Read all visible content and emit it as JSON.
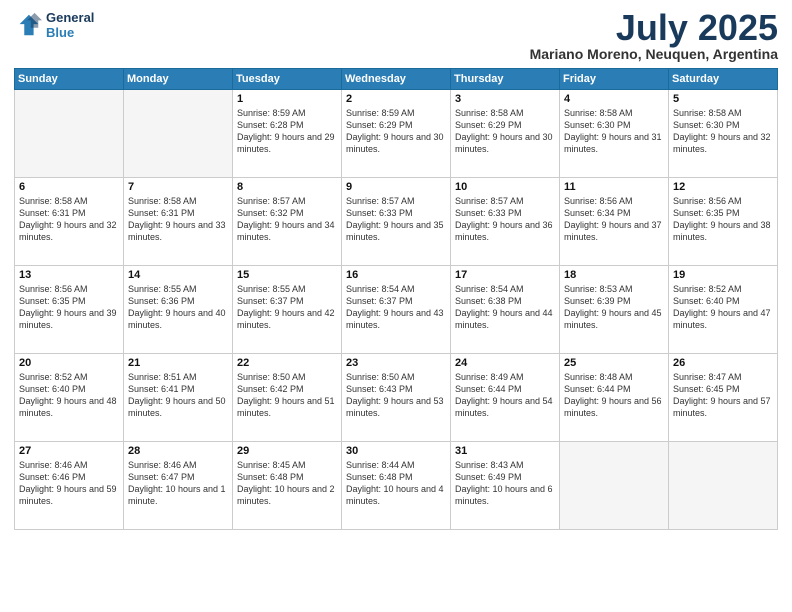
{
  "logo": {
    "line1": "General",
    "line2": "Blue"
  },
  "title": "July 2025",
  "location": "Mariano Moreno, Neuquen, Argentina",
  "weekdays": [
    "Sunday",
    "Monday",
    "Tuesday",
    "Wednesday",
    "Thursday",
    "Friday",
    "Saturday"
  ],
  "weeks": [
    [
      {
        "day": "",
        "sunrise": "",
        "sunset": "",
        "daylight": ""
      },
      {
        "day": "",
        "sunrise": "",
        "sunset": "",
        "daylight": ""
      },
      {
        "day": "1",
        "sunrise": "Sunrise: 8:59 AM",
        "sunset": "Sunset: 6:28 PM",
        "daylight": "Daylight: 9 hours and 29 minutes."
      },
      {
        "day": "2",
        "sunrise": "Sunrise: 8:59 AM",
        "sunset": "Sunset: 6:29 PM",
        "daylight": "Daylight: 9 hours and 30 minutes."
      },
      {
        "day": "3",
        "sunrise": "Sunrise: 8:58 AM",
        "sunset": "Sunset: 6:29 PM",
        "daylight": "Daylight: 9 hours and 30 minutes."
      },
      {
        "day": "4",
        "sunrise": "Sunrise: 8:58 AM",
        "sunset": "Sunset: 6:30 PM",
        "daylight": "Daylight: 9 hours and 31 minutes."
      },
      {
        "day": "5",
        "sunrise": "Sunrise: 8:58 AM",
        "sunset": "Sunset: 6:30 PM",
        "daylight": "Daylight: 9 hours and 32 minutes."
      }
    ],
    [
      {
        "day": "6",
        "sunrise": "Sunrise: 8:58 AM",
        "sunset": "Sunset: 6:31 PM",
        "daylight": "Daylight: 9 hours and 32 minutes."
      },
      {
        "day": "7",
        "sunrise": "Sunrise: 8:58 AM",
        "sunset": "Sunset: 6:31 PM",
        "daylight": "Daylight: 9 hours and 33 minutes."
      },
      {
        "day": "8",
        "sunrise": "Sunrise: 8:57 AM",
        "sunset": "Sunset: 6:32 PM",
        "daylight": "Daylight: 9 hours and 34 minutes."
      },
      {
        "day": "9",
        "sunrise": "Sunrise: 8:57 AM",
        "sunset": "Sunset: 6:33 PM",
        "daylight": "Daylight: 9 hours and 35 minutes."
      },
      {
        "day": "10",
        "sunrise": "Sunrise: 8:57 AM",
        "sunset": "Sunset: 6:33 PM",
        "daylight": "Daylight: 9 hours and 36 minutes."
      },
      {
        "day": "11",
        "sunrise": "Sunrise: 8:56 AM",
        "sunset": "Sunset: 6:34 PM",
        "daylight": "Daylight: 9 hours and 37 minutes."
      },
      {
        "day": "12",
        "sunrise": "Sunrise: 8:56 AM",
        "sunset": "Sunset: 6:35 PM",
        "daylight": "Daylight: 9 hours and 38 minutes."
      }
    ],
    [
      {
        "day": "13",
        "sunrise": "Sunrise: 8:56 AM",
        "sunset": "Sunset: 6:35 PM",
        "daylight": "Daylight: 9 hours and 39 minutes."
      },
      {
        "day": "14",
        "sunrise": "Sunrise: 8:55 AM",
        "sunset": "Sunset: 6:36 PM",
        "daylight": "Daylight: 9 hours and 40 minutes."
      },
      {
        "day": "15",
        "sunrise": "Sunrise: 8:55 AM",
        "sunset": "Sunset: 6:37 PM",
        "daylight": "Daylight: 9 hours and 42 minutes."
      },
      {
        "day": "16",
        "sunrise": "Sunrise: 8:54 AM",
        "sunset": "Sunset: 6:37 PM",
        "daylight": "Daylight: 9 hours and 43 minutes."
      },
      {
        "day": "17",
        "sunrise": "Sunrise: 8:54 AM",
        "sunset": "Sunset: 6:38 PM",
        "daylight": "Daylight: 9 hours and 44 minutes."
      },
      {
        "day": "18",
        "sunrise": "Sunrise: 8:53 AM",
        "sunset": "Sunset: 6:39 PM",
        "daylight": "Daylight: 9 hours and 45 minutes."
      },
      {
        "day": "19",
        "sunrise": "Sunrise: 8:52 AM",
        "sunset": "Sunset: 6:40 PM",
        "daylight": "Daylight: 9 hours and 47 minutes."
      }
    ],
    [
      {
        "day": "20",
        "sunrise": "Sunrise: 8:52 AM",
        "sunset": "Sunset: 6:40 PM",
        "daylight": "Daylight: 9 hours and 48 minutes."
      },
      {
        "day": "21",
        "sunrise": "Sunrise: 8:51 AM",
        "sunset": "Sunset: 6:41 PM",
        "daylight": "Daylight: 9 hours and 50 minutes."
      },
      {
        "day": "22",
        "sunrise": "Sunrise: 8:50 AM",
        "sunset": "Sunset: 6:42 PM",
        "daylight": "Daylight: 9 hours and 51 minutes."
      },
      {
        "day": "23",
        "sunrise": "Sunrise: 8:50 AM",
        "sunset": "Sunset: 6:43 PM",
        "daylight": "Daylight: 9 hours and 53 minutes."
      },
      {
        "day": "24",
        "sunrise": "Sunrise: 8:49 AM",
        "sunset": "Sunset: 6:44 PM",
        "daylight": "Daylight: 9 hours and 54 minutes."
      },
      {
        "day": "25",
        "sunrise": "Sunrise: 8:48 AM",
        "sunset": "Sunset: 6:44 PM",
        "daylight": "Daylight: 9 hours and 56 minutes."
      },
      {
        "day": "26",
        "sunrise": "Sunrise: 8:47 AM",
        "sunset": "Sunset: 6:45 PM",
        "daylight": "Daylight: 9 hours and 57 minutes."
      }
    ],
    [
      {
        "day": "27",
        "sunrise": "Sunrise: 8:46 AM",
        "sunset": "Sunset: 6:46 PM",
        "daylight": "Daylight: 9 hours and 59 minutes."
      },
      {
        "day": "28",
        "sunrise": "Sunrise: 8:46 AM",
        "sunset": "Sunset: 6:47 PM",
        "daylight": "Daylight: 10 hours and 1 minute."
      },
      {
        "day": "29",
        "sunrise": "Sunrise: 8:45 AM",
        "sunset": "Sunset: 6:48 PM",
        "daylight": "Daylight: 10 hours and 2 minutes."
      },
      {
        "day": "30",
        "sunrise": "Sunrise: 8:44 AM",
        "sunset": "Sunset: 6:48 PM",
        "daylight": "Daylight: 10 hours and 4 minutes."
      },
      {
        "day": "31",
        "sunrise": "Sunrise: 8:43 AM",
        "sunset": "Sunset: 6:49 PM",
        "daylight": "Daylight: 10 hours and 6 minutes."
      },
      {
        "day": "",
        "sunrise": "",
        "sunset": "",
        "daylight": ""
      },
      {
        "day": "",
        "sunrise": "",
        "sunset": "",
        "daylight": ""
      }
    ]
  ]
}
